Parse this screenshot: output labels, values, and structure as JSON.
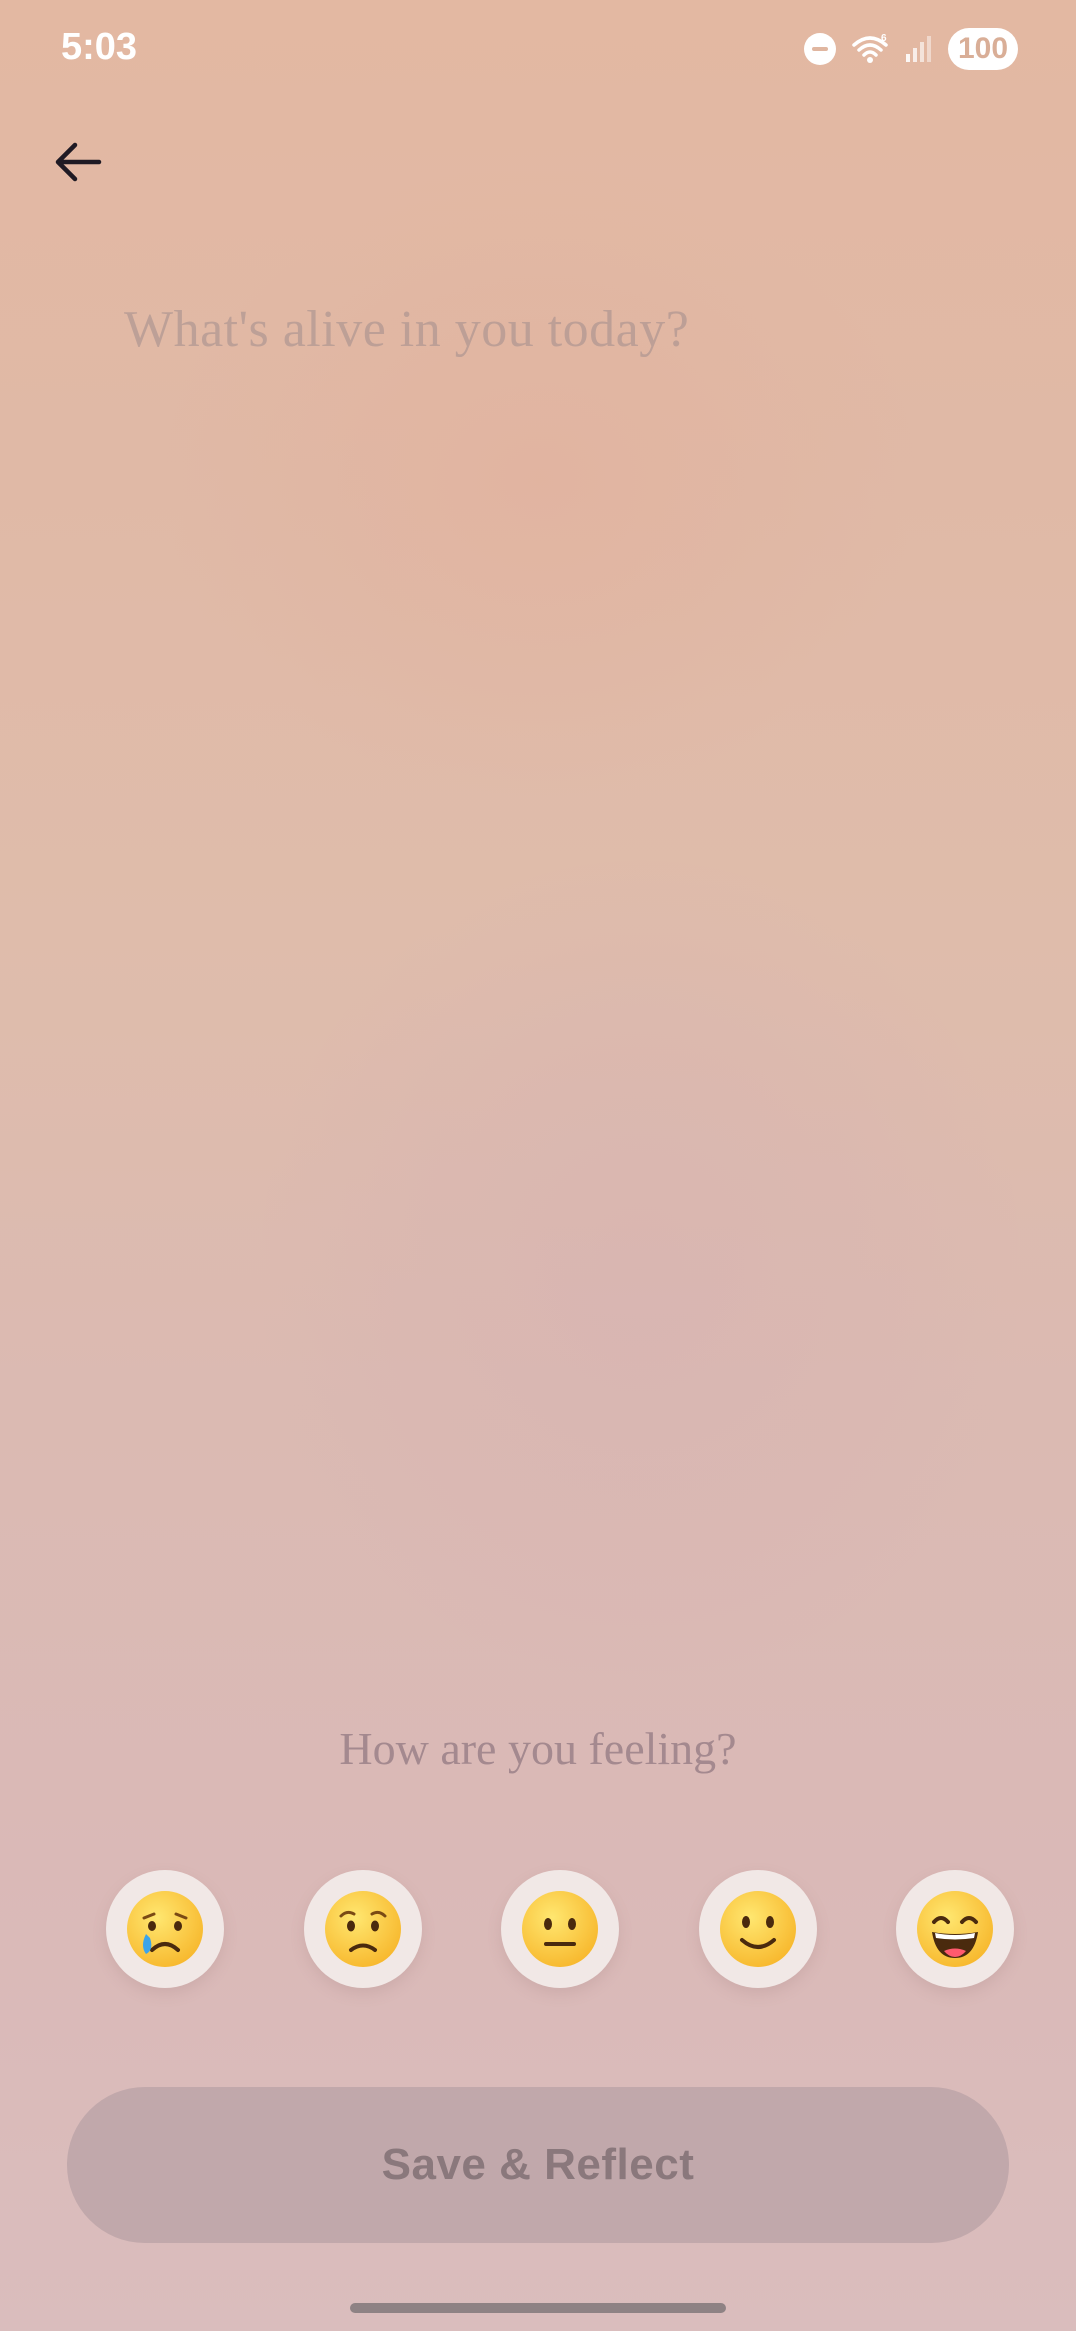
{
  "status_bar": {
    "time": "5:03",
    "battery": "100",
    "icons": [
      "do-not-disturb-icon",
      "wifi-icon",
      "signal-icon",
      "battery-icon"
    ]
  },
  "header": {
    "back_icon": "arrow-left-icon"
  },
  "journal": {
    "placeholder": "What's alive in you today?",
    "value": ""
  },
  "mood": {
    "label": "How are you feeling?",
    "options": [
      {
        "name": "crying-face",
        "icon": "crying-face-icon"
      },
      {
        "name": "worried-face",
        "icon": "worried-face-icon"
      },
      {
        "name": "neutral-face",
        "icon": "neutral-face-icon"
      },
      {
        "name": "slightly-smiling-face",
        "icon": "slightly-smiling-face-icon"
      },
      {
        "name": "grinning-face",
        "icon": "grinning-face-icon"
      }
    ]
  },
  "actions": {
    "save_label": "Save & Reflect"
  },
  "colors": {
    "background_top": "#e3b8a2",
    "background_bottom": "#dabdbd",
    "save_button": "#c1a8ab",
    "save_text": "#8a787c",
    "mood_label": "#a4898f"
  }
}
